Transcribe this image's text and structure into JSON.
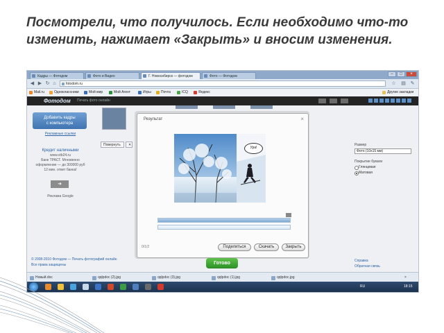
{
  "slide": {
    "title": "Посмотрели, что получилось. Если необходимо что-то изменить, нажимает «Закрыть» и вносим изменения."
  },
  "browser": {
    "tabs": [
      "Кадры — Фотодом",
      "Фото и Видео",
      "Г. Новосибирск — фотодом",
      "Фото — Фотодом"
    ],
    "url": "fotodom.ru",
    "bookmarks": [
      {
        "label": "Mail.ru",
        "icon": "mail-icon",
        "color": "#e8892b"
      },
      {
        "label": "Одноклассники",
        "icon": "ok-icon",
        "color": "#f2a23a"
      },
      {
        "label": "Мой мир",
        "icon": "mymir-icon",
        "color": "#3b6fb6"
      },
      {
        "label": "Мой Агент",
        "icon": "agent-icon",
        "color": "#2f8f3f"
      },
      {
        "label": "Игры",
        "icon": "games-icon",
        "color": "#3b6fb6"
      },
      {
        "label": "Почта",
        "icon": "postal-icon",
        "color": "#e0b21e"
      },
      {
        "label": "ICQ",
        "icon": "icq-icon",
        "color": "#4ca64c"
      },
      {
        "label": "Яндекс",
        "icon": "yandex-icon",
        "color": "#d63c2f"
      }
    ],
    "bookmarks_right": "Другие закладки"
  },
  "site": {
    "logo": "Фотодом",
    "tagline": "Печать фото онлайн",
    "cta": [
      "Добавить кадры",
      "с компьютера"
    ],
    "credit_title": "Кредит наличными",
    "credit_lines": [
      "www.vtb24.ru",
      "Банк ТРАСТ. Мгновенно",
      "оформление — до 300000 руб",
      "12 мин. ответ банка!"
    ],
    "credit_link": "Рекламные ссылки",
    "ads_label": "Реклама Google",
    "toolbar": {
      "rotate": "Повернуть",
      "delete": "Удалить"
    },
    "right_panel": {
      "size_label": "Размер",
      "size_value": "Фото (10x15 мм)",
      "paper_label": "Покрытие бумаги",
      "options": [
        "Глянцевая",
        "Матовая"
      ]
    },
    "done_button": "Готово",
    "footer_left": [
      "© 2008-2010 Фотодом — Печать фотографий онлайн",
      "Все права защищены"
    ],
    "footer_right": [
      "Справка",
      "Обратная связь"
    ]
  },
  "modal": {
    "title": "Результат",
    "bubble": "Ура!",
    "progress": 1.0,
    "status": "0/1/2",
    "buttons": [
      "Поделиться",
      "Скачать",
      "Закрыть"
    ]
  },
  "downloads": [
    "Новый.doc",
    "qqlpdoc (2).jpg",
    "qqlpdoc (3).jpg",
    "qqlpdoc (1).jpg",
    "qqlpdoc.jpg"
  ],
  "taskbar": {
    "tray": "RU",
    "clock": "18:15"
  }
}
